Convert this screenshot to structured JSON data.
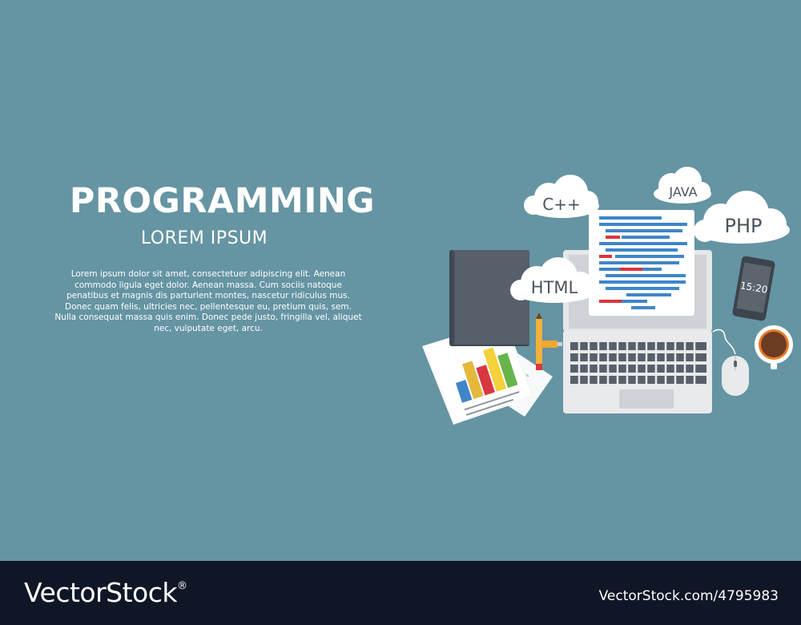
{
  "banner": {
    "title": "PROGRAMMING",
    "subtitle": "LOREM IPSUM",
    "body": "Lorem ipsum dolor sit amet, consectetuer adipiscing elit. Aenean commodo ligula eget dolor. Aenean massa. Cum sociis natoque penatibus et magnis dis parturient montes, nascetur ridiculus mus. Donec quam felis, ultricies nec, pellentesque eu, pretium quis, sem. Nulla consequat massa quis enim. Donec pede justo, fringilla vel, aliquet nec, vulputate eget, arcu."
  },
  "clouds": {
    "cpp": "C++",
    "java": "JAVA",
    "php": "PHP",
    "html": "HTML"
  },
  "phone": {
    "time": "15:20"
  },
  "footer": {
    "brand": "VectorStock",
    "registered": "®",
    "image_id": "VectorStock.com/4795983"
  },
  "colors": {
    "background": "#6594a3",
    "footer": "#0f1626",
    "code_blue": "#3f86c9",
    "code_red": "#d9363e"
  }
}
